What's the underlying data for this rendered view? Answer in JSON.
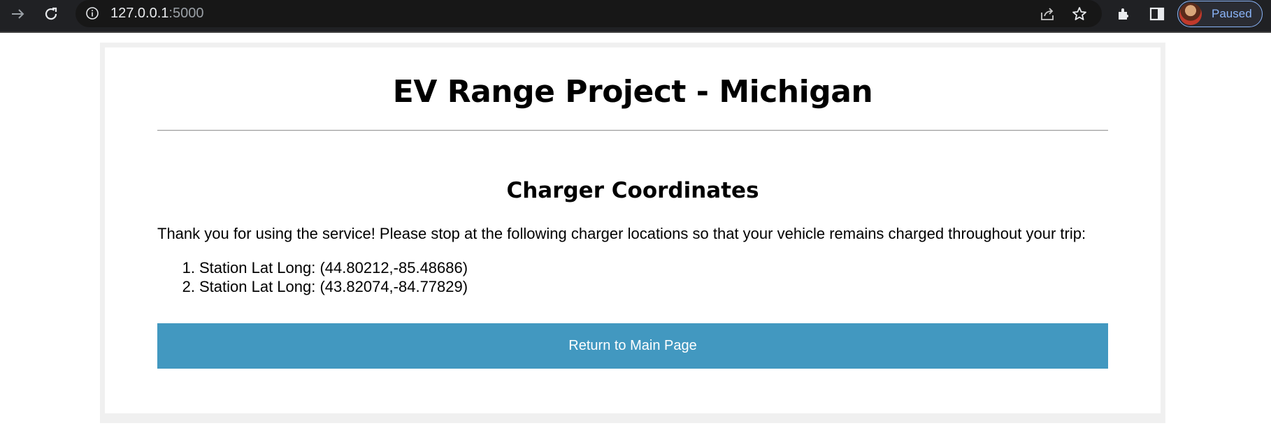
{
  "browser": {
    "url_host": "127.0.0.1",
    "url_port": ":5000",
    "profile_status": "Paused",
    "icons": [
      "forward-icon",
      "reload-icon",
      "info-icon",
      "share-icon",
      "star-icon",
      "extensions-icon",
      "side-panel-icon",
      "avatar"
    ]
  },
  "page": {
    "title": "EV Range Project - Michigan",
    "subtitle": "Charger Coordinates",
    "message": "Thank you for using the service! Please stop at the following charger locations so that your vehicle remains charged throughout your trip:",
    "stations": [
      {
        "num": "1.",
        "label": "Station Lat Long: (44.80212,-85.48686)"
      },
      {
        "num": "2.",
        "label": "Station Lat Long: (43.82074,-84.77829)"
      }
    ],
    "return_button": "Return to Main Page"
  },
  "colors": {
    "toolbar_bg": "#202124",
    "button_bg": "#4298c0",
    "button_text": "#ffffff",
    "page_frame": "#f0f0f0"
  }
}
